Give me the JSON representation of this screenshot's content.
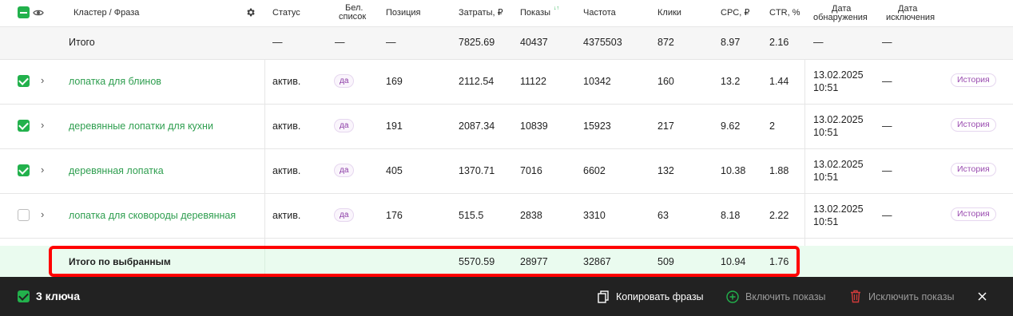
{
  "header": {
    "cluster_phrase": "Кластер / Фраза",
    "status": "Статус",
    "whitelist_line1": "Бел.",
    "whitelist_line2": "список",
    "position": "Позиция",
    "cost": "Затраты, ₽",
    "impressions": "Показы",
    "frequency": "Частота",
    "clicks": "Клики",
    "cpc": "CPC, ₽",
    "ctr": "CTR, %",
    "detect_line1": "Дата",
    "detect_line2": "обнаружения",
    "excl_line1": "Дата",
    "excl_line2": "исключения"
  },
  "total": {
    "label": "Итого",
    "status": "—",
    "whitelist": "—",
    "position": "—",
    "cost": "7825.69",
    "impressions": "40437",
    "frequency": "4375503",
    "clicks": "872",
    "cpc": "8.97",
    "ctr": "2.16",
    "detect": "—",
    "excl": "—"
  },
  "rows": [
    {
      "checked": true,
      "phrase": "лопатка для блинов",
      "status": "актив.",
      "whitelist": "да",
      "position": "169",
      "cost": "2112.54",
      "impressions": "11122",
      "frequency": "10342",
      "clicks": "160",
      "cpc": "13.2",
      "ctr": "1.44",
      "date": "13.02.2025",
      "time": "10:51",
      "excl": "—",
      "history": "История"
    },
    {
      "checked": true,
      "phrase": "деревянные лопатки для кухни",
      "status": "актив.",
      "whitelist": "да",
      "position": "191",
      "cost": "2087.34",
      "impressions": "10839",
      "frequency": "15923",
      "clicks": "217",
      "cpc": "9.62",
      "ctr": "2",
      "date": "13.02.2025",
      "time": "10:51",
      "excl": "—",
      "history": "История"
    },
    {
      "checked": true,
      "phrase": "деревянная лопатка",
      "status": "актив.",
      "whitelist": "да",
      "position": "405",
      "cost": "1370.71",
      "impressions": "7016",
      "frequency": "6602",
      "clicks": "132",
      "cpc": "10.38",
      "ctr": "1.88",
      "date": "13.02.2025",
      "time": "10:51",
      "excl": "—",
      "history": "История"
    },
    {
      "checked": false,
      "phrase": "лопатка для сковороды деревянная",
      "status": "актив.",
      "whitelist": "да",
      "position": "176",
      "cost": "515.5",
      "impressions": "2838",
      "frequency": "3310",
      "clicks": "63",
      "cpc": "8.18",
      "ctr": "2.22",
      "date": "13.02.2025",
      "time": "10:51",
      "excl": "—",
      "history": "История"
    }
  ],
  "selected_total": {
    "label": "Итого по выбранным",
    "cost": "5570.59",
    "impressions": "28977",
    "frequency": "32867",
    "clicks": "509",
    "cpc": "10.94",
    "ctr": "1.76"
  },
  "footer": {
    "selected_count": "3 ключа",
    "copy": "Копировать фразы",
    "enable": "Включить показы",
    "exclude": "Исключить показы"
  },
  "colors": {
    "accent": "#22b14c",
    "phrase": "#2e9e4f",
    "highlight": "#ff0000",
    "footer_bg": "#222222",
    "selection_bg": "#eafbef"
  }
}
